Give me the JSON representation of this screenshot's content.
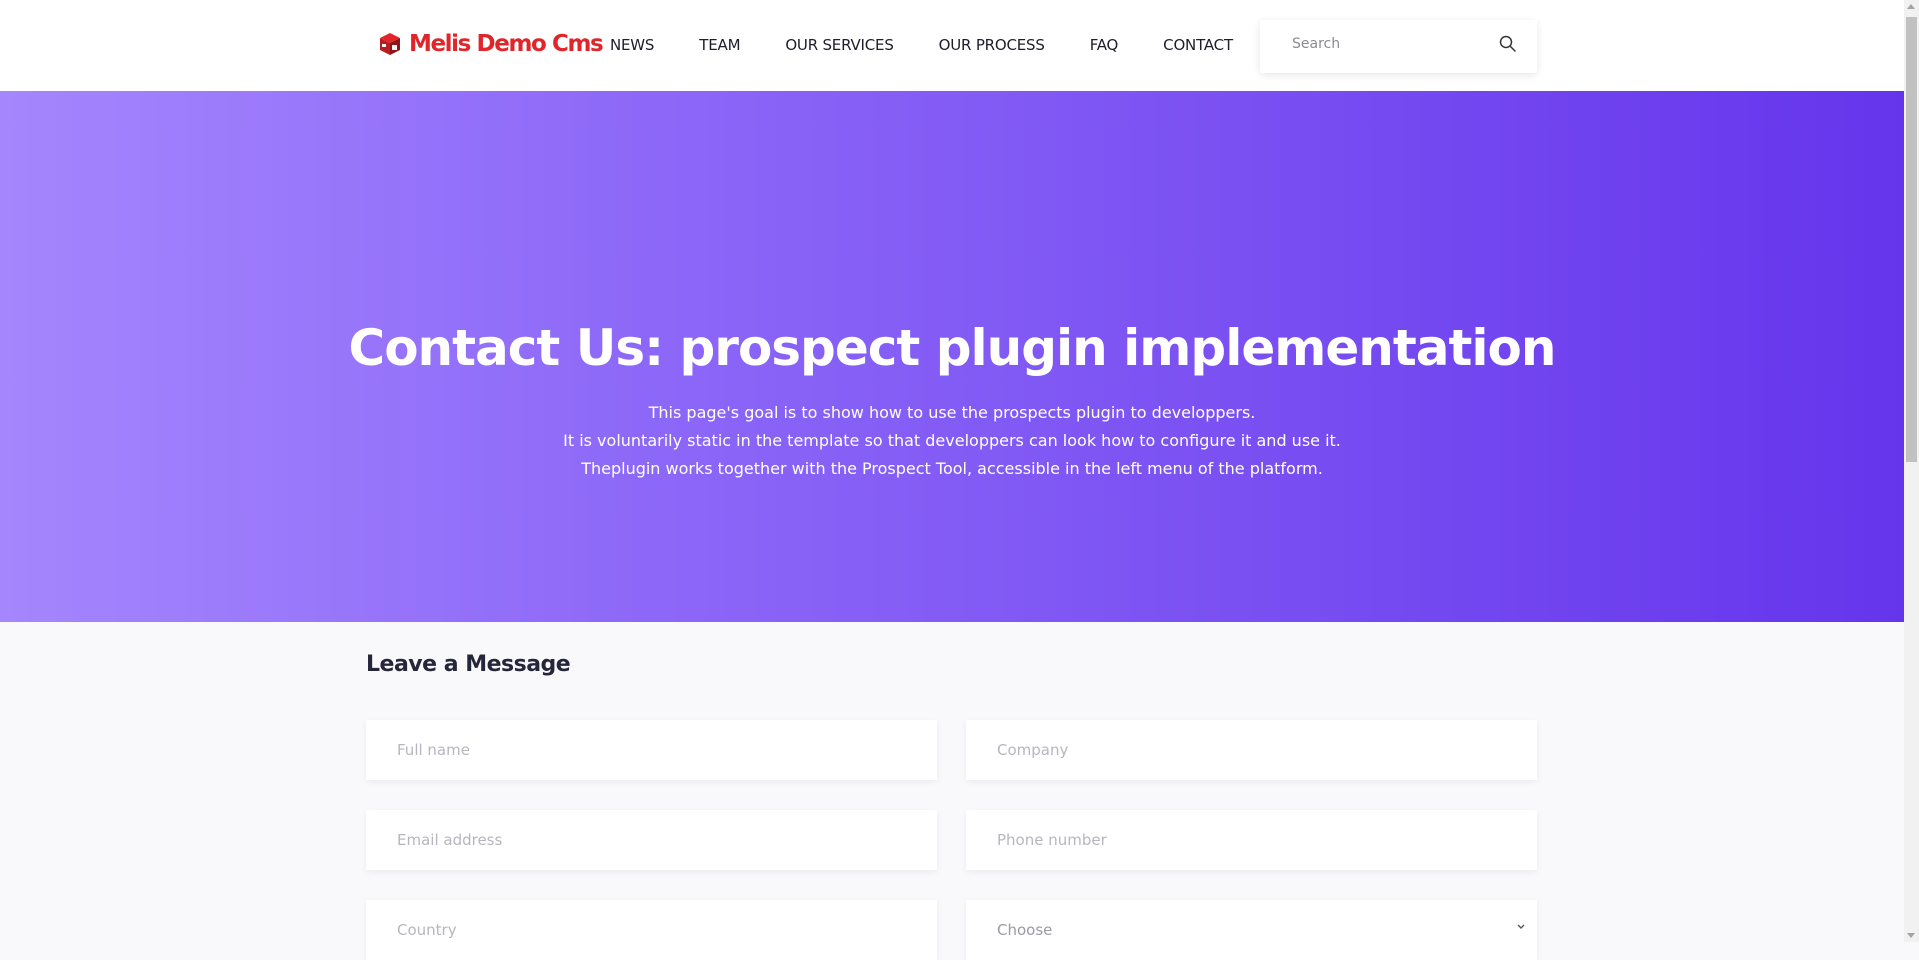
{
  "brand": {
    "name": "Melis Demo Cms",
    "color": "#e0262b"
  },
  "nav": {
    "items": [
      {
        "label": "NEWS"
      },
      {
        "label": "TEAM"
      },
      {
        "label": "OUR SERVICES"
      },
      {
        "label": "OUR PROCESS"
      },
      {
        "label": "FAQ"
      },
      {
        "label": "CONTACT"
      }
    ]
  },
  "search": {
    "placeholder": "Search",
    "icon": "search-icon"
  },
  "hero": {
    "title": "Contact Us: prospect plugin implementation",
    "lines": [
      "This page's goal is to show how to use the prospects plugin to developpers.",
      "It is voluntarily static in the template so that developpers can look how to configure it and use it.",
      "Theplugin works together with the Prospect Tool, accessible in the left menu of the platform."
    ],
    "gradient_start": "#a586fd",
    "gradient_end": "#6535ec"
  },
  "form": {
    "title": "Leave a Message",
    "fields": {
      "full_name": {
        "placeholder": "Full name"
      },
      "company": {
        "placeholder": "Company"
      },
      "email": {
        "placeholder": "Email address"
      },
      "phone": {
        "placeholder": "Phone number"
      },
      "country": {
        "placeholder": "Country"
      },
      "choose": {
        "value": "Choose"
      }
    }
  }
}
